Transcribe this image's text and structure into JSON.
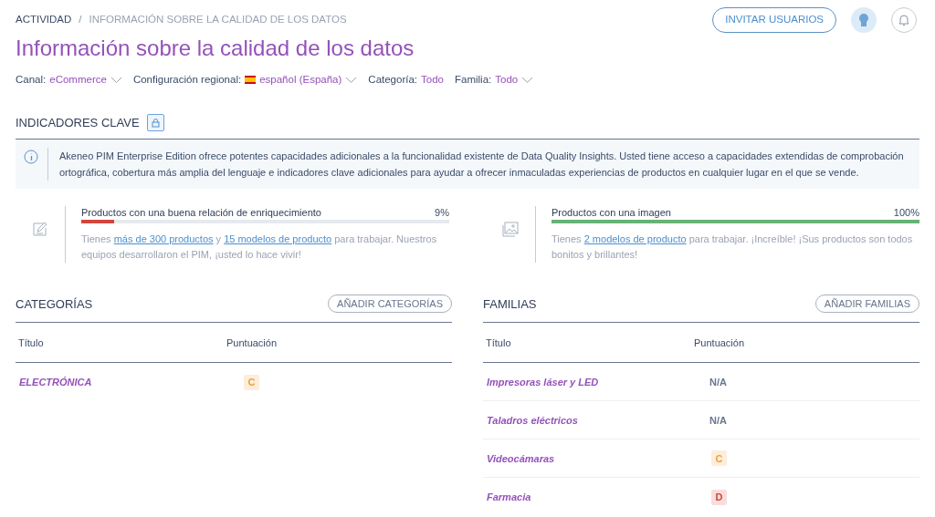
{
  "breadcrumb": [
    {
      "label": "ACTIVIDAD",
      "selected": false
    },
    {
      "label": "INFORMACIÓN SOBRE LA CALIDAD DE LOS DATOS",
      "selected": true
    }
  ],
  "breadcrumb_separator": "/",
  "header_buttons": {
    "invite": "INVITAR USUARIOS"
  },
  "title": "Información sobre la calidad de los datos",
  "filters": [
    {
      "label": "Canal:",
      "value": "eCommerce",
      "dropdown": true,
      "flag": false
    },
    {
      "label": "Configuración regional:",
      "value": "español (España)",
      "dropdown": true,
      "flag": true
    },
    {
      "label": "Categoría:",
      "value": "Todo",
      "dropdown": false,
      "flag": false
    },
    {
      "label": "Familia:",
      "value": "Todo",
      "dropdown": true,
      "flag": false
    }
  ],
  "key_indicators": {
    "title": "INDICADORES CLAVE",
    "info": "Akeneo PIM Enterprise Edition ofrece potentes capacidades adicionales a la funcionalidad existente de Data Quality Insights. Usted tiene acceso a capacidades extendidas de comprobación ortográfica, cobertura más amplia del lenguaje e indicadores clave adicionales para ayudar a ofrecer inmaculadas experiencias de productos en cualquier lugar en el que se vende.",
    "items": [
      {
        "kind": "edit",
        "label": "Productos con una buena relación de enriquecimiento",
        "percent": "9%",
        "level": 0.09,
        "color": "#d4463c",
        "description": [
          {
            "text": "Tienes ",
            "link": false
          },
          {
            "text": "más de 300 productos",
            "link": true
          },
          {
            "text": " y ",
            "link": false
          },
          {
            "text": "15 modelos de producto",
            "link": true
          },
          {
            "text": " para trabajar. Nuestros equipos desarrollaron el PIM, ¡usted lo hace vivir!",
            "link": false
          }
        ]
      },
      {
        "kind": "image",
        "label": "Productos con una imagen",
        "percent": "100%",
        "level": 1,
        "color": "#67b373",
        "description": [
          {
            "text": "Tienes ",
            "link": false
          },
          {
            "text": "2 modelos de producto",
            "link": true
          },
          {
            "text": " para trabajar. ¡Increíble! ¡Sus productos son todos bonitos y brillantes!",
            "link": false
          }
        ]
      }
    ]
  },
  "sections": [
    {
      "title": "CATEGORÍAS",
      "button": "AÑADIR CATEGORÍAS",
      "columns": [
        "Título",
        "Puntuación"
      ],
      "rows": [
        {
          "title": "ELECTRÓNICA",
          "score": {
            "kind": "badge",
            "text": "C",
            "color": "#f19e38"
          }
        }
      ]
    },
    {
      "title": "FAMILIAS",
      "button": "AÑADIR FAMILIAS",
      "columns": [
        "Título",
        "Puntuación"
      ],
      "rows": [
        {
          "title": "Impresoras láser y LED",
          "score": {
            "kind": "text",
            "text": "N/A"
          }
        },
        {
          "title": "Taladros eléctricos",
          "score": {
            "kind": "text",
            "text": "N/A"
          }
        },
        {
          "title": "Videocámaras",
          "score": {
            "kind": "badge",
            "text": "C",
            "color": "#f19e38"
          }
        },
        {
          "title": "Farmacia",
          "score": {
            "kind": "badge",
            "text": "D",
            "color": "#d4463c"
          }
        }
      ]
    }
  ]
}
